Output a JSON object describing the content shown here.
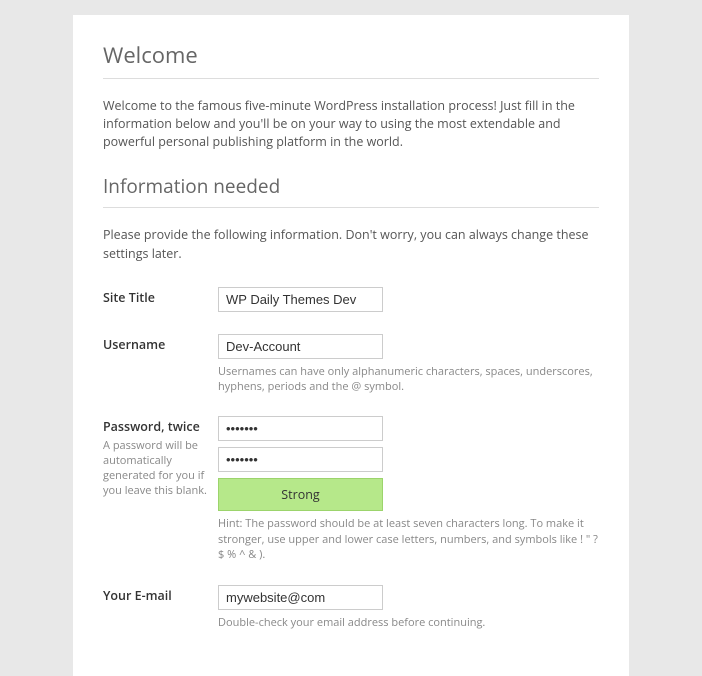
{
  "headings": {
    "welcome": "Welcome",
    "info_needed": "Information needed"
  },
  "intro_text": "Welcome to the famous five-minute WordPress installation process! Just fill in the information below and you'll be on your way to using the most extendable and powerful personal publishing platform in the world.",
  "subintro_text": "Please provide the following information. Don't worry, you can always change these settings later.",
  "fields": {
    "site_title": {
      "label": "Site Title",
      "value": "WP Daily Themes Dev"
    },
    "username": {
      "label": "Username",
      "value": "Dev-Account",
      "hint": "Usernames can have only alphanumeric characters, spaces, underscores, hyphens, periods and the @ symbol."
    },
    "password": {
      "label": "Password, twice",
      "label_hint": "A password will be automatically generated for you if you leave this blank.",
      "value1": "•••••••",
      "value2": "•••••••",
      "strength": "Strong",
      "hint": "Hint: The password should be at least seven characters long. To make it stronger, use upper and lower case letters, numbers, and symbols like ! \" ? $ % ^ & )."
    },
    "email": {
      "label": "Your E-mail",
      "value": "mywebsite@com",
      "hint": "Double-check your email address before continuing."
    }
  }
}
